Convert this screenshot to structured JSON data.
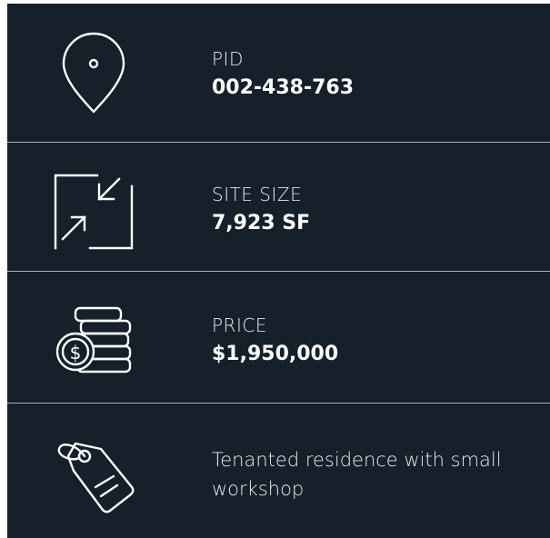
{
  "rows": [
    {
      "icon": "location-pin-icon",
      "label": "PID",
      "value": "002-438-763"
    },
    {
      "icon": "resize-arrows-icon",
      "label": "SITE SIZE",
      "value": "7,923 SF"
    },
    {
      "icon": "coin-stack-icon",
      "label": "PRICE",
      "value": "$1,950,000"
    },
    {
      "icon": "price-tag-icon",
      "description": "Tenanted residence with small workshop"
    }
  ],
  "colors": {
    "background": "#15202b",
    "divider": "#aab1b8",
    "text": "#ffffff"
  }
}
